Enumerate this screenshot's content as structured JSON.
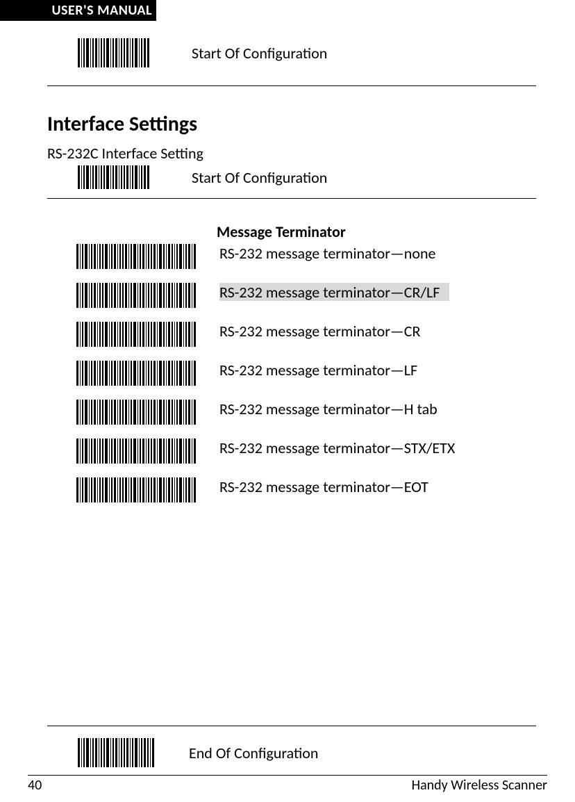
{
  "header": {
    "tab_label": "USER'S MANUAL"
  },
  "top": {
    "barcode_label": "Start Of Configuration"
  },
  "section1": {
    "heading": "Interface Settings",
    "subheading": "RS-232C Interface Setting",
    "barcode_label": "Start Of Configuration"
  },
  "message_terminator": {
    "title": "Message Terminator",
    "items": [
      {
        "label": "RS-232 message terminator—none",
        "highlight": false
      },
      {
        "label": "RS-232 message terminator—CR/LF",
        "highlight": true
      },
      {
        "label": "RS-232 message terminator—CR",
        "highlight": false
      },
      {
        "label": "RS-232 message terminator—LF",
        "highlight": false
      },
      {
        "label": "RS-232 message terminator—H tab",
        "highlight": false
      },
      {
        "label": "RS-232 message terminator—STX/ETX",
        "highlight": false
      },
      {
        "label": "RS-232 message terminator—EOT",
        "highlight": false
      }
    ]
  },
  "bottom": {
    "barcode_label": "End Of Configuration"
  },
  "footer": {
    "page_number": "40",
    "doc_title": "Handy Wireless Scanner"
  }
}
